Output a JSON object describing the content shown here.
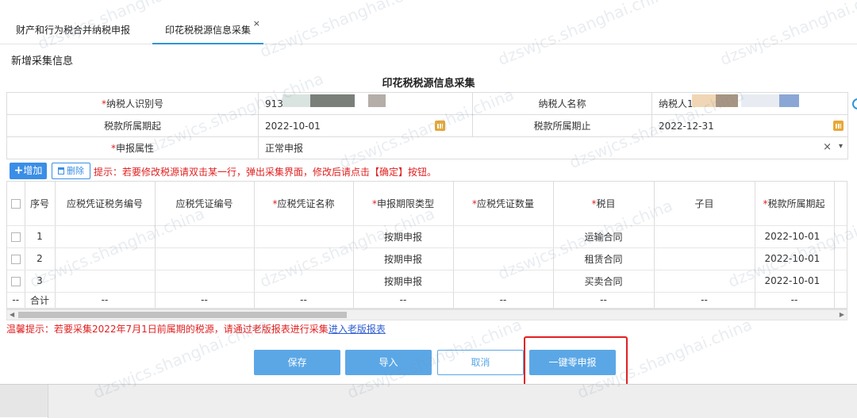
{
  "tabs": [
    {
      "label": "财产和行为税合并纳税申报"
    },
    {
      "label": "印花税税源信息采集",
      "close": "×"
    }
  ],
  "section_title": "新增采集信息",
  "form_title": "印花税税源信息采集",
  "info": {
    "taxpayer_id_label": "纳税人识别号",
    "taxpayer_id_value": "913",
    "taxpayer_name_label": "纳税人名称",
    "taxpayer_name_value": "纳税人1",
    "period_start_label": "税款所属期起",
    "period_start_value": "2022-10-01",
    "period_end_label": "税款所属期止",
    "period_end_value": "2022-12-31",
    "declare_attr_label": "申报属性",
    "declare_attr_value": "正常申报",
    "clear_icon": "×",
    "dropdown_icon": "▾",
    "required_mark": "*"
  },
  "toolbar": {
    "add_label": "增加",
    "add_icon": "+",
    "delete_label": "删除",
    "hint": "提示：若要修改税源请双击某一行，弹出采集界面，修改后请点击【确定】按钮。"
  },
  "table": {
    "headers": [
      "序号",
      "应税凭证税务编号",
      "应税凭证编号",
      "*应税凭证名称",
      "*申报期限类型",
      "*应税凭证数量",
      "*税目",
      "子目",
      "*税款所属期起"
    ],
    "rows": [
      {
        "no": "1",
        "tax_no": "",
        "cert_no": "",
        "name": "",
        "period_type": "按期申报",
        "qty": "",
        "item": "运输合同",
        "sub": "",
        "start": "2022-10-01"
      },
      {
        "no": "2",
        "tax_no": "",
        "cert_no": "",
        "name": "",
        "period_type": "按期申报",
        "qty": "",
        "item": "租赁合同",
        "sub": "",
        "start": "2022-10-01"
      },
      {
        "no": "3",
        "tax_no": "",
        "cert_no": "",
        "name": "",
        "period_type": "按期申报",
        "qty": "",
        "item": "买卖合同",
        "sub": "",
        "start": "2022-10-01"
      }
    ],
    "sum_row": {
      "first": "--",
      "label": "合计",
      "dash": "--"
    }
  },
  "warning": {
    "text": "温馨提示：若要采集2022年7月1日前属期的税源，请通过老版报表进行采集",
    "link": "进入老版报表"
  },
  "buttons": {
    "save": "保存",
    "import": "导入",
    "cancel": "取消",
    "zero_declare": "一键零申报"
  },
  "watermark": "dzswjcs.shanghai.china",
  "colors": {
    "primary": "#3a8ee6",
    "button": "#5ba7e6",
    "required": "#e02020",
    "highlight": "#e22020",
    "calendar": "#e8a834"
  }
}
